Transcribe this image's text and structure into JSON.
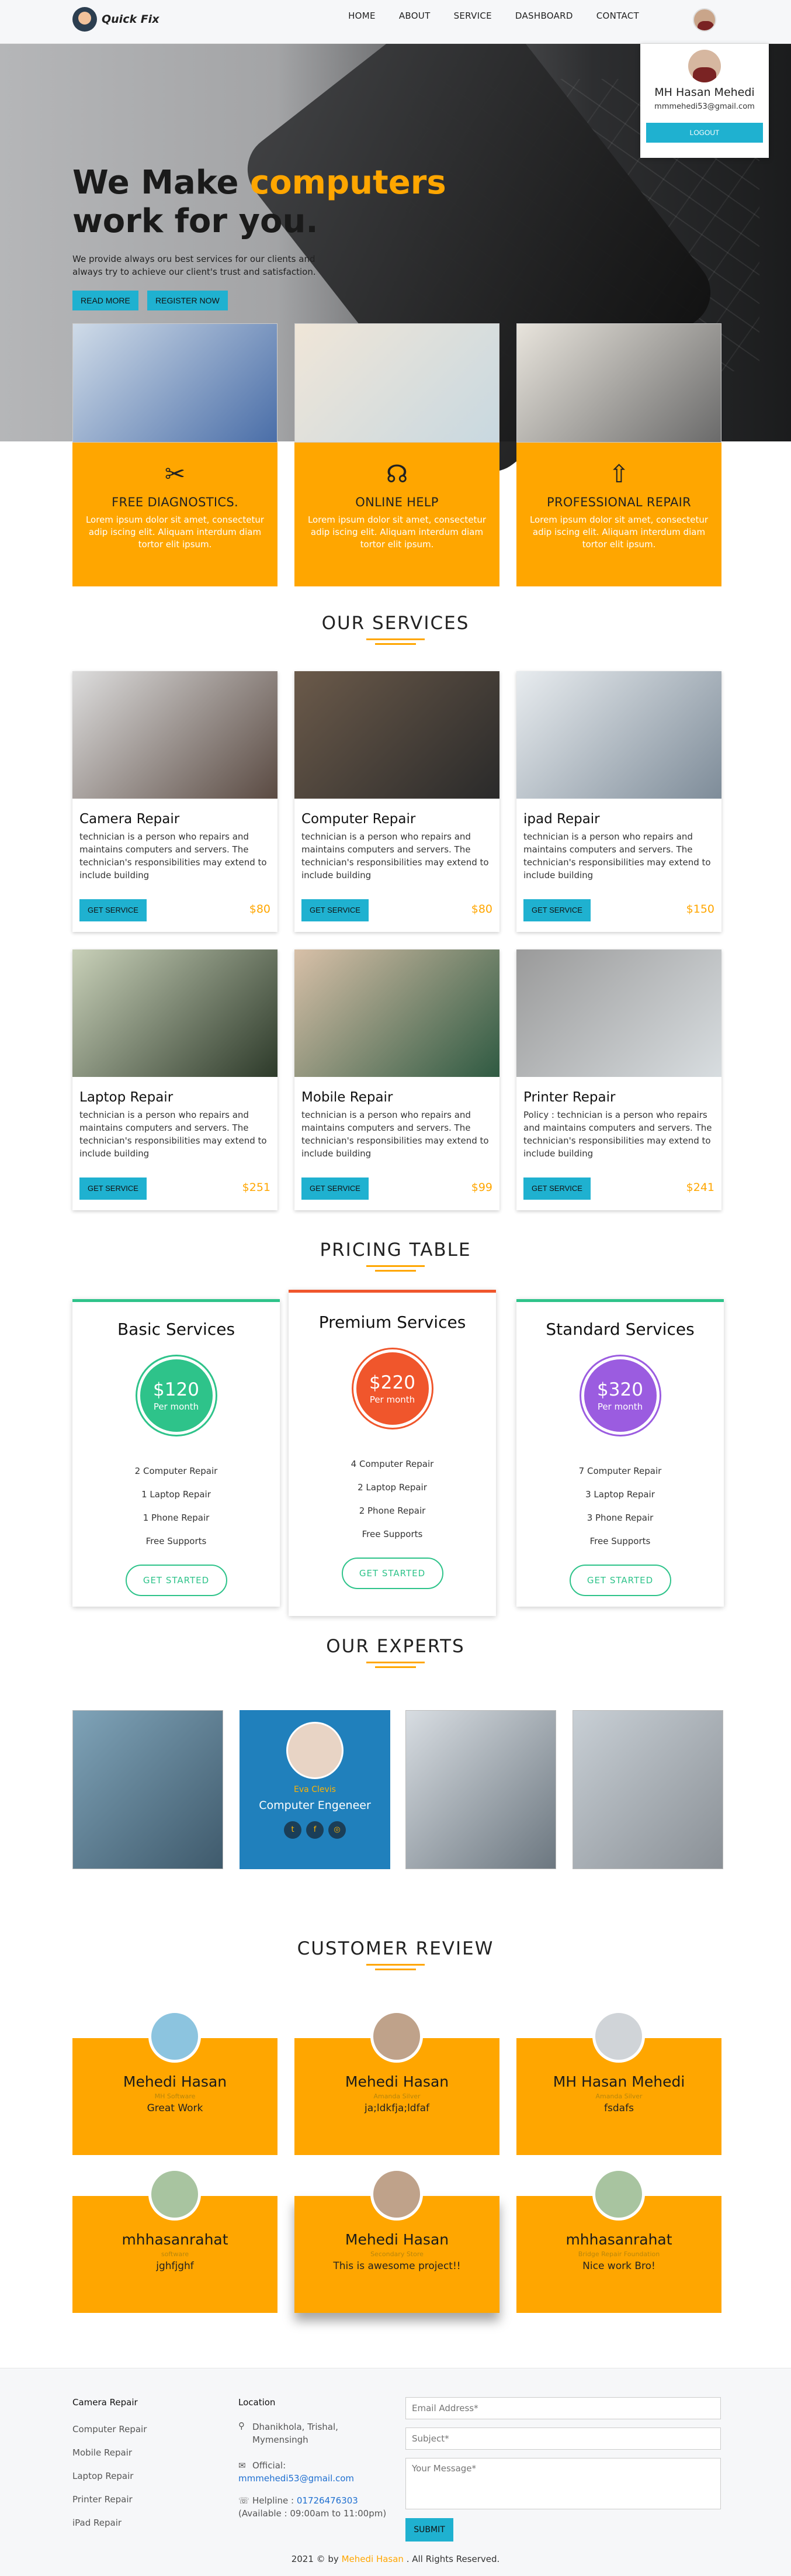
{
  "brand": {
    "name": "Quick Fix"
  },
  "nav": {
    "items": [
      "HOME",
      "ABOUT",
      "SERVICE",
      "DASHBOARD",
      "CONTACT"
    ]
  },
  "profile": {
    "name": "MH Hasan Mehedi",
    "email": "mmmehedi53@gmail.com",
    "logout": "LOGOUT"
  },
  "hero": {
    "title_a": "We Make ",
    "title_hl": "computers",
    "title_b": "work for you.",
    "text": "We provide always oru best services for our clients and always try to achieve our client's trust and satisfaction.",
    "read_more": "READ MORE",
    "register": "REGISTER NOW"
  },
  "features": [
    {
      "icon": "wrench-icon",
      "title": "FREE DIAGNOSTICS.",
      "text": "Lorem ipsum dolor sit amet, consectetur adip iscing elit. Aliquam interdum diam tortor elit ipsum."
    },
    {
      "icon": "headset-icon",
      "title": "ONLINE HELP",
      "text": "Lorem ipsum dolor sit amet, consectetur adip iscing elit. Aliquam interdum diam tortor elit ipsum."
    },
    {
      "icon": "rocket-icon",
      "title": "PROFESSIONAL REPAIR",
      "text": "Lorem ipsum dolor sit amet, consectetur adip iscing elit. Aliquam interdum diam tortor elit ipsum."
    }
  ],
  "services_title": "OUR SERVICES",
  "services": [
    {
      "title": "Camera Repair",
      "text": "technician is a person who repairs and maintains computers and servers. The technician's responsibilities may extend to include building",
      "price": "$80",
      "button": "GET SERVICE"
    },
    {
      "title": "Computer Repair",
      "text": "technician is a person who repairs and maintains computers and servers. The technician's responsibilities may extend to include building",
      "price": "$80",
      "button": "GET SERVICE"
    },
    {
      "title": "ipad Repair",
      "text": "technician is a person who repairs and maintains computers and servers. The technician's responsibilities may extend to include building",
      "price": "$150",
      "button": "GET SERVICE"
    },
    {
      "title": "Laptop Repair",
      "text": "technician is a person who repairs and maintains computers and servers. The technician's responsibilities may extend to include building",
      "price": "$251",
      "button": "GET SERVICE"
    },
    {
      "title": "Mobile Repair",
      "text": "technician is a person who repairs and maintains computers and servers. The technician's responsibilities may extend to include building",
      "price": "$99",
      "button": "GET SERVICE"
    },
    {
      "title": "Printer Repair",
      "text": "Policy : technician is a person who repairs and maintains computers and servers. The technician's responsibilities may extend to include building",
      "price": "$241",
      "button": "GET SERVICE"
    }
  ],
  "pricing_title": "PRICING TABLE",
  "plans": [
    {
      "name": "Basic Services",
      "price": "$120",
      "per": "Per month",
      "color": "#2ec38a",
      "items": [
        "2 Computer Repair",
        "1 Laptop Repair",
        "1 Phone Repair",
        "Free Supports"
      ],
      "button": "GET STARTED"
    },
    {
      "name": "Premium Services",
      "price": "$220",
      "per": "Per month",
      "color": "#f0562c",
      "items": [
        "4 Computer Repair",
        "2 Laptop Repair",
        "2 Phone Repair",
        "Free Supports"
      ],
      "button": "GET STARTED"
    },
    {
      "name": "Standard Services",
      "price": "$320",
      "per": "Per month",
      "color": "#9b5ce0",
      "items": [
        "7 Computer Repair",
        "3 Laptop Repair",
        "3 Phone Repair",
        "Free Supports"
      ],
      "button": "GET STARTED"
    }
  ],
  "experts_title": "OUR EXPERTS",
  "expert_featured": {
    "name": "Eva Clevis",
    "role": "Computer Engeneer"
  },
  "reviews_title": "CUSTOMER REVIEW",
  "reviews": [
    {
      "name": "Mehedi Hasan",
      "sub": "MH Software",
      "msg": "Great Work"
    },
    {
      "name": "Mehedi Hasan",
      "sub": "Amanda Silver",
      "msg": "ja;ldkfja;ldfaf"
    },
    {
      "name": "MH Hasan Mehedi",
      "sub": "Amanda Silver",
      "msg": "fsdafs"
    },
    {
      "name": "mhhasanrahat",
      "sub": "software",
      "msg": "jghfjghf"
    },
    {
      "name": "Mehedi Hasan",
      "sub": "Secondary Store",
      "msg": "This is awesome project!!"
    },
    {
      "name": "mhhasanrahat",
      "sub": "Bridge Repair Foundation",
      "msg": "Nice work Bro!"
    }
  ],
  "footer": {
    "services_head": "Camera Repair",
    "services": [
      "Computer Repair",
      "Mobile Repair",
      "Laptop Repair",
      "Printer Repair",
      "iPad Repair"
    ],
    "location_head": "Location",
    "address": "Dhanikhola, Trishal, Mymensingh",
    "official_label": "Official:",
    "official_email": "mmmehedi53@gmail.com",
    "helpline_label": "Helpline : ",
    "helpline_number": "01726476303",
    "helpline_hours": "(Available : 09:00am to 11:00pm)",
    "email_ph": "Email Address*",
    "subject_ph": "Subject*",
    "message_ph": "Your Message*",
    "submit": "SUBMIT",
    "copy_a": "2021 © by ",
    "copy_by": "Mehedi Hasan",
    "copy_b": " . All Rights Reserved."
  }
}
